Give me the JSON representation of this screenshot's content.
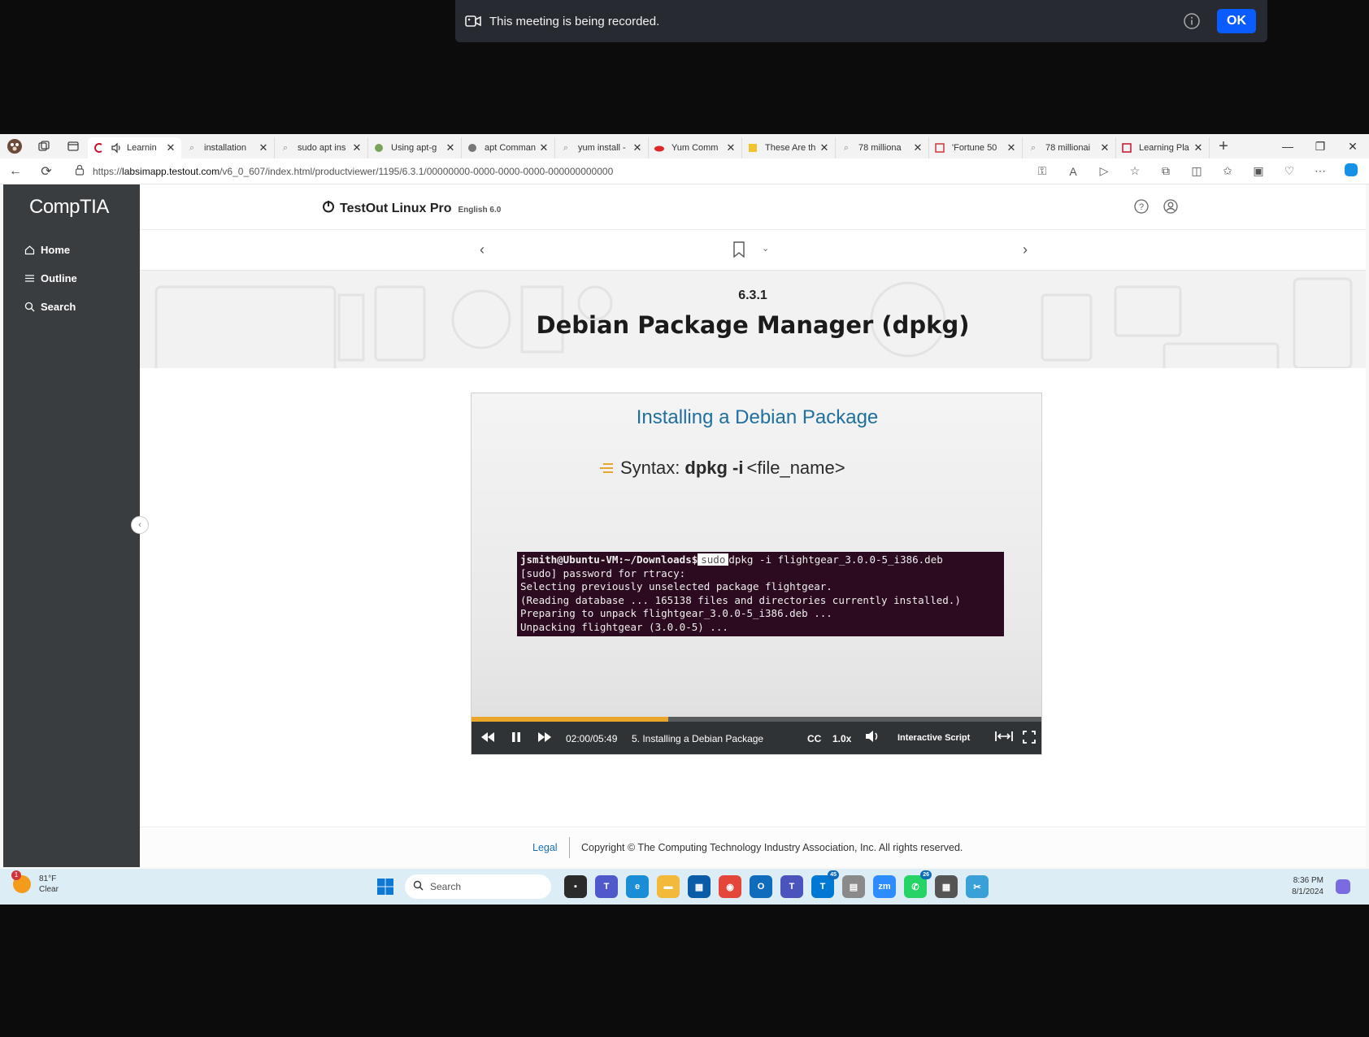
{
  "recording_banner": {
    "message": "This meeting is being recorded.",
    "ok_label": "OK"
  },
  "browser": {
    "tabs": [
      {
        "title": "Learnin",
        "active": true
      },
      {
        "title": "installation"
      },
      {
        "title": "sudo apt ins"
      },
      {
        "title": "Using apt-g"
      },
      {
        "title": "apt Comman"
      },
      {
        "title": "yum install -"
      },
      {
        "title": "Yum Comm"
      },
      {
        "title": "These Are th"
      },
      {
        "title": "78 milliona"
      },
      {
        "title": "'Fortune 50"
      },
      {
        "title": "78 millionai"
      },
      {
        "title": "Learning Pla"
      }
    ],
    "url_prefix": "https://",
    "url_host": "labsimapp.testout.com",
    "url_path": "/v6_0_607/index.html/productviewer/1195/6.3.1/00000000-0000-0000-0000-000000000000"
  },
  "sidebar": {
    "logo": "CompTIA",
    "items": [
      {
        "label": "Home",
        "icon": "home-icon"
      },
      {
        "label": "Outline",
        "icon": "list-icon"
      },
      {
        "label": "Search",
        "icon": "search-icon"
      }
    ]
  },
  "header": {
    "product": "TestOut Linux Pro",
    "language": "English 6.0"
  },
  "lesson": {
    "number": "6.3.1",
    "title": "Debian Package Manager (dpkg)"
  },
  "video": {
    "slide_title": "Installing a Debian Package",
    "syntax_label": "Syntax:",
    "syntax_command": "dpkg -i",
    "syntax_arg": "<file_name>",
    "terminal": {
      "prompt": "jsmith@Ubuntu-VM:~/Downloads$",
      "sudo": "sudo",
      "command": "dpkg -i flightgear_3.0.0-5_i386.deb",
      "lines": [
        "[sudo] password for rtracy:",
        "Selecting previously unselected package flightgear.",
        "(Reading database ... 165138 files and directories currently installed.)",
        "Preparing to unpack flightgear_3.0.0-5_i386.deb ...",
        "Unpacking flightgear (3.0.0-5) ..."
      ]
    },
    "time": "02:00/05:49",
    "chapter": "5. Installing a Debian Package",
    "cc": "CC",
    "speed": "1.0x",
    "script_label": "Interactive Script",
    "progress_fraction": 0.344,
    "progress_color": "#e9a62b"
  },
  "footer": {
    "legal": "Legal",
    "copyright": "Copyright © The Computing Technology Industry Association, Inc. All rights reserved."
  },
  "taskbar": {
    "weather_temp": "81°F",
    "weather_cond": "Clear",
    "weather_badge": "1",
    "search_placeholder": "Search",
    "time": "8:36 PM",
    "date": "8/1/2024",
    "teams_badge": "45",
    "whatsapp_badge": "26"
  }
}
